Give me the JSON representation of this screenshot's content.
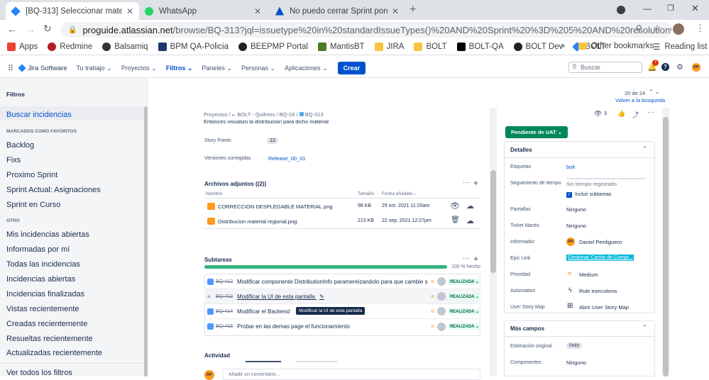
{
  "browser": {
    "tabs": [
      {
        "title": "[BQ-313] Seleccionar material en",
        "active": true,
        "color": "#2684ff"
      },
      {
        "title": "WhatsApp",
        "active": false,
        "color": "#25d366"
      },
      {
        "title": "No puedo cerrar Sprint porque h",
        "active": false,
        "color": "#0052cc"
      }
    ],
    "url_host": "proguide.atlassian.net",
    "url_path": "/browse/BQ-313?jql=issuetype%20in%20standardIssueTypes()%20AND%20Sprint%20%3D%205%20AND%20resolution%20%3D%20Unr...",
    "bookmarks": [
      {
        "label": "Apps",
        "color": "#ea4335"
      },
      {
        "label": "Redmine",
        "color": "#b32024"
      },
      {
        "label": "Balsamiq",
        "color": "#333333"
      },
      {
        "label": "BPM QA-Policia",
        "color": "#1a3a6b"
      },
      {
        "label": "BEEPMP Portal",
        "color": "#222222"
      },
      {
        "label": "MantisBT",
        "color": "#4a7d2a"
      },
      {
        "label": "JIRA",
        "color": "#f4c542"
      },
      {
        "label": "BOLT",
        "color": "#f4c542"
      },
      {
        "label": "BOLT-QA",
        "color": "#000000"
      },
      {
        "label": "BOLT Dev",
        "color": "#222222"
      },
      {
        "label": "BOLT",
        "color": "#2684ff"
      }
    ],
    "more": "»",
    "other_bookmarks": "Other bookmarks",
    "reading_list": "Reading list"
  },
  "jira": {
    "product": "Jira Software",
    "nav": [
      "Tu trabajo",
      "Proyectos",
      "Filtros",
      "Paneles",
      "Personas",
      "Aplicaciones"
    ],
    "selected_nav": "Filtros",
    "create": "Crear",
    "search_placeholder": "Buscar",
    "notif_count": "7",
    "avatar": "DP"
  },
  "sidebar": {
    "title": "Filtros",
    "search": "Buscar incidencias",
    "fav_header": "MARCADOS COMO FAVORITOS",
    "favs": [
      "Backlog",
      "Fixs",
      "Proximo Sprint",
      "Sprint Actual: Asignaciones",
      "Sprint en Curso"
    ],
    "other_header": "OTRO",
    "others": [
      "Mis incidencias abiertas",
      "Informadas por mí",
      "Todas las incidencias",
      "Incidencias abiertas",
      "Incidencias finalizadas",
      "Vistas recientemente",
      "Creadas recientemente",
      "Resueltas recientemente",
      "Actualizadas recientemente"
    ],
    "all": "Ver todos los filtros"
  },
  "issue": {
    "pager": "20 de 24",
    "back": "Volver a la búsqueda",
    "breadcrumb": [
      "Proyectos",
      "BOLT - Quilmes",
      "BQ-24",
      "BQ-313"
    ],
    "cut_text": "Entonces visualizo la distribucion para dicho material",
    "story_points_label": "Story Points",
    "story_points": "13",
    "fix_label": "Versiones corregidas",
    "fix_version": "Release_00_01",
    "attach_title": "Archivos adjuntos ((2))",
    "attach_cols": [
      "Nombre",
      "Tamaño",
      "Fecha añadida"
    ],
    "attachments": [
      {
        "name": "CORRECCION DESPLEGABLE MATERIAL.png",
        "size": "98 KB",
        "date": "29 oct. 2021 11:20am"
      },
      {
        "name": "Distribucion material regional.png",
        "size": "213 KB",
        "date": "22 sep. 2021 12:27pm"
      }
    ],
    "subtasks_title": "Subtareas",
    "progress_label": "100 % hecho",
    "progress": 1.0,
    "subtasks": [
      {
        "key": "BQ-412",
        "summary": "Modificar componente DistributionInfo paramereizandolo para que cambie su ...",
        "status": "REALIZADA"
      },
      {
        "key": "BQ-413",
        "summary": "Modificar la UI de esta pantalla",
        "status": "REALIZADA"
      },
      {
        "key": "BQ-414",
        "summary": "Modificar el Backend",
        "status": "REALIZADA"
      },
      {
        "key": "BQ-415",
        "summary": "Probar en las demas page el funcionamiento",
        "status": "REALIZADA"
      }
    ],
    "tooltip": "Modificar la UI de esta pantalla",
    "activity": "Actividad",
    "comment_placeholder": "Añadir un comentario..."
  },
  "panel": {
    "watchers": "3",
    "status": "Pendiente de UAT",
    "details": "Detalles",
    "fields": [
      {
        "label": "Etiquetas",
        "value": "bolt"
      },
      {
        "label": "Seguimiento de tiempo",
        "value": "Sin tiempo registrado"
      },
      {
        "label": "",
        "value": "Incluir subtareas"
      },
      {
        "label": "Pantallas",
        "value": "Ninguno"
      },
      {
        "label": "Ticket Mantis",
        "value": "Ninguno"
      },
      {
        "label": "Informador",
        "value": "Daniel Perdiguero"
      },
      {
        "label": "Epic Link",
        "value": "Gestionar Carrito de Compr..."
      },
      {
        "label": "Prioridad",
        "value": "Medium"
      },
      {
        "label": "Automation",
        "value": "Rule executions"
      },
      {
        "label": "User Story Map",
        "value": "Abrir User Story Map"
      }
    ],
    "more_fields": "Más campos",
    "more": [
      {
        "label": "Estimación original",
        "value": "0min"
      },
      {
        "label": "Componentes",
        "value": "Ninguno"
      }
    ]
  }
}
